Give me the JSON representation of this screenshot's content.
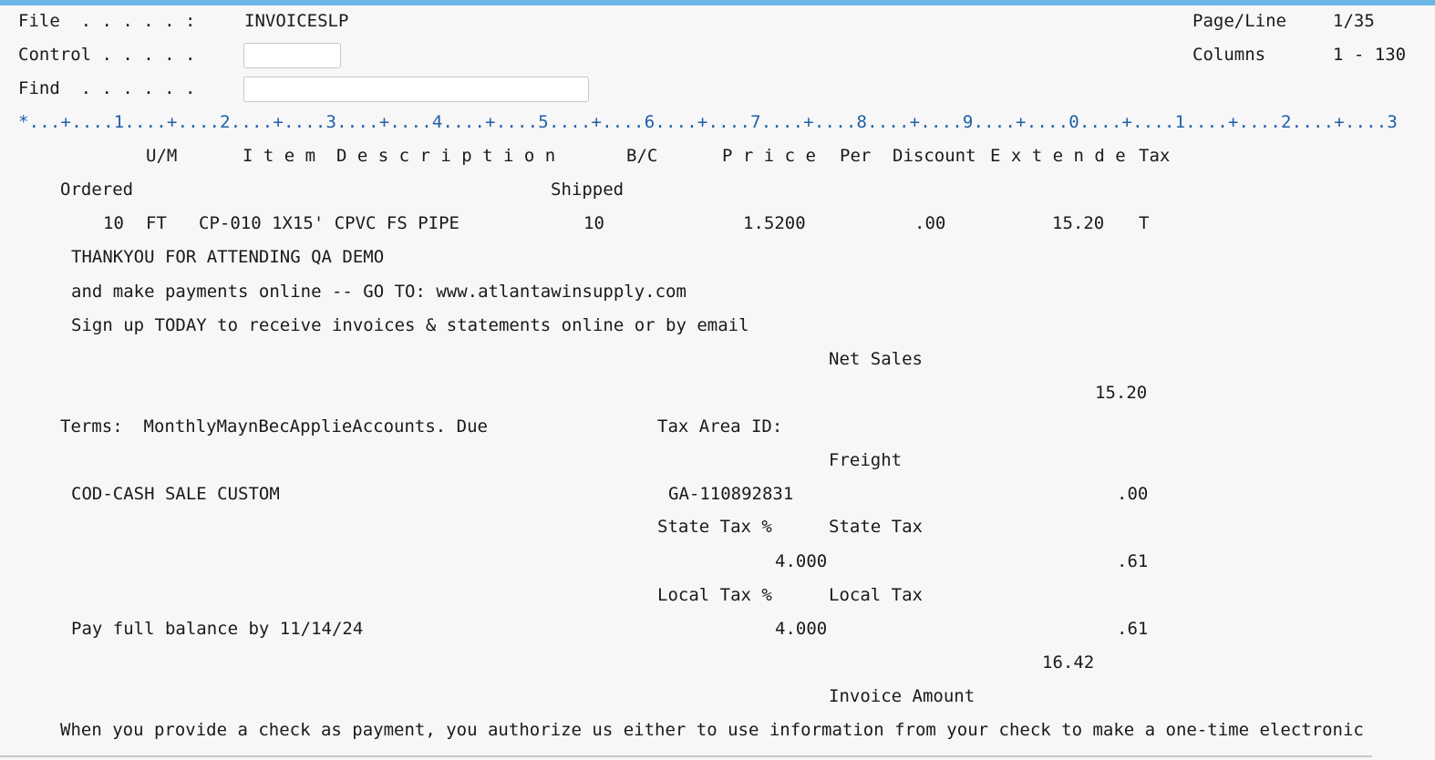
{
  "header": {
    "file_label": "File  . . . . . :",
    "file_value": "INVOICESLP",
    "control_label": "Control . . . . .",
    "control_value": "",
    "find_label": "Find  . . . . . .",
    "find_value": "",
    "page_line_label": "Page/Line",
    "page_line_value": "1/35",
    "columns_label": "Columns",
    "columns_value": "1 - 130"
  },
  "ruler": "*...+....1....+....2....+....3....+....4....+....5....+....6....+....7....+....8....+....9....+....0....+....1....+....2....+....3",
  "columns": {
    "um": "U/M",
    "item_description": "I t e m  D e s c r i p t i o n",
    "bc": "B/C",
    "price": "P r i c e",
    "per": "Per",
    "discount": "Discount",
    "extended": "E x t e n d e",
    "tax": "Tax",
    "ordered": "Ordered",
    "shipped": "Shipped"
  },
  "line_item": {
    "ordered": "10",
    "um": "FT",
    "description": "CP-010 1X15' CPVC FS PIPE",
    "shipped": "10",
    "price": "1.5200",
    "discount": ".00",
    "extended": "15.20",
    "tax": "T"
  },
  "messages": [
    "THANKYOU FOR ATTENDING QA DEMO",
    "and make payments online -- GO TO: www.atlantawinsupply.com",
    "Sign up TODAY to receive invoices & statements online or by email"
  ],
  "totals": {
    "net_sales_label": "Net Sales",
    "net_sales_value": "15.20",
    "terms": "Terms:  MonthlyMaynBecApplieAccounts. Due",
    "tax_area_label": "Tax Area ID:",
    "freight_label": "Freight",
    "cod_text": "COD-CASH SALE CUSTOM",
    "tax_area_value": "GA-110892831",
    "freight_value": ".00",
    "state_tax_pct_label": "State Tax %",
    "state_tax_label": "State Tax",
    "state_tax_pct_value": "4.000",
    "state_tax_value": ".61",
    "local_tax_pct_label": "Local Tax %",
    "local_tax_label": "Local Tax",
    "pay_by_text": "Pay full balance by 11/14/24",
    "local_tax_pct_value": "4.000",
    "local_tax_value": ".61",
    "invoice_amount_value": "16.42",
    "invoice_amount_label": "Invoice Amount"
  },
  "footer_text": "When you provide a check as payment, you authorize us either to use information from your check to make a one-time electronic"
}
